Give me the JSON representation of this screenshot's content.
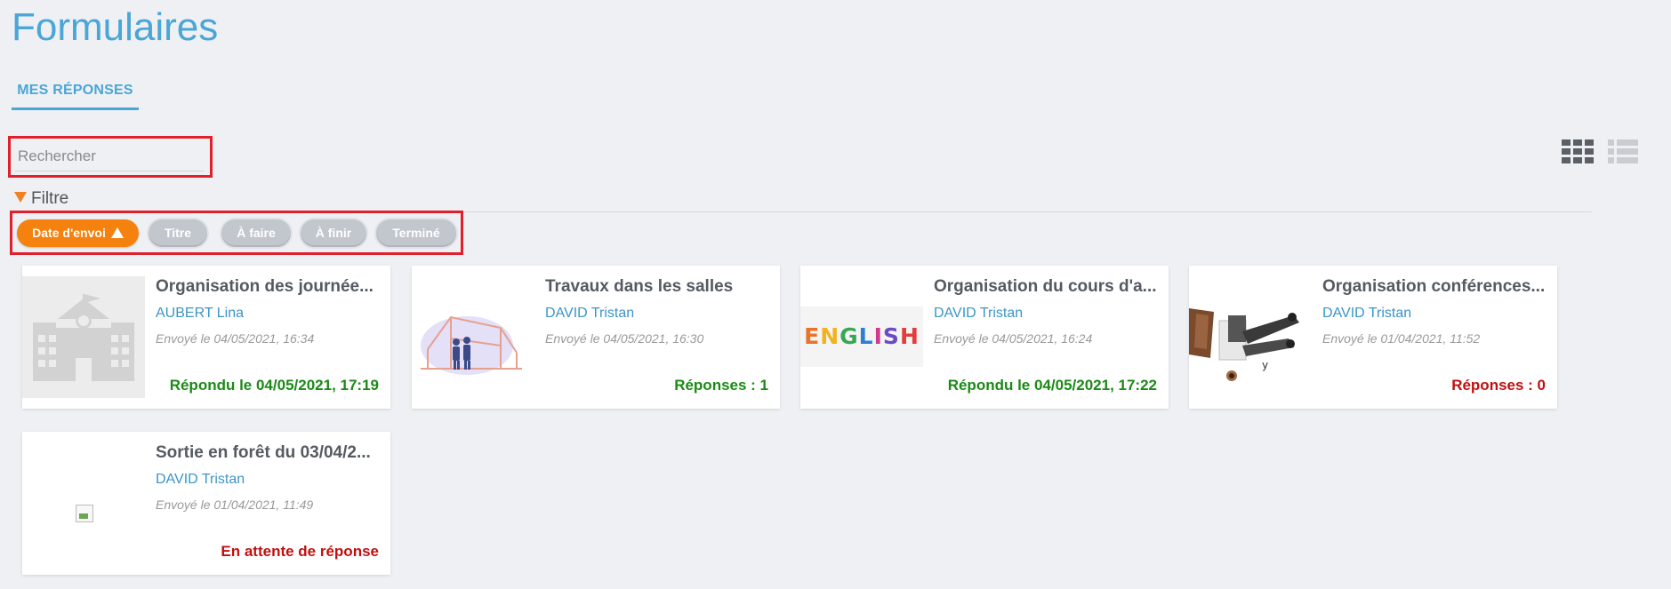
{
  "page": {
    "title": "Formulaires"
  },
  "tabs": [
    {
      "label": "MES RÉPONSES",
      "active": true
    }
  ],
  "search": {
    "placeholder": "Rechercher",
    "value": ""
  },
  "view_toggle": {
    "grid_icon": "grid-view-icon",
    "list_icon": "list-view-icon",
    "active": "grid"
  },
  "filter": {
    "label": "Filtre",
    "arrow_icon": "triangle-down-icon",
    "pills": [
      {
        "label": "Date d'envoi",
        "active": true,
        "sort_icon": "triangle-up-icon"
      },
      {
        "label": "Titre",
        "active": false
      },
      {
        "label": "À faire",
        "active": false
      },
      {
        "label": "À finir",
        "active": false
      },
      {
        "label": "Terminé",
        "active": false
      }
    ]
  },
  "colors": {
    "accent": "#4aa6d6",
    "active_pill": "#f5820e",
    "status_green": "#1b8a16",
    "status_red": "#c01010",
    "highlight_border": "#e0202a"
  },
  "cards": [
    {
      "title": "Organisation des journée...",
      "author": "AUBERT Lina",
      "sent": "Envoyé le 04/05/2021, 16:34",
      "status": "Répondu le 04/05/2021, 17:19",
      "status_color": "green",
      "thumbnail": "school-building-icon"
    },
    {
      "title": "Travaux dans les salles",
      "author": "DAVID Tristan",
      "sent": "Envoyé le 04/05/2021, 16:30",
      "status": "Réponses : 1",
      "status_color": "green",
      "thumbnail": "construction-illustration"
    },
    {
      "title": "Organisation du cours d'a...",
      "author": "DAVID Tristan",
      "sent": "Envoyé le 04/05/2021, 16:24",
      "status": "Répondu le 04/05/2021, 17:22",
      "status_color": "green",
      "thumbnail": "english-text-image",
      "thumbnail_text": "ENGLISH"
    },
    {
      "title": "Organisation conférences...",
      "author": "DAVID Tristan",
      "sent": "Envoyé le 01/04/2021, 11:52",
      "status": "Réponses : 0",
      "status_color": "red",
      "thumbnail": "desk-illustration"
    },
    {
      "title": "Sortie en forêt du 03/04/2...",
      "author": "DAVID Tristan",
      "sent": "Envoyé le 01/04/2021, 11:49",
      "status": "En attente de réponse",
      "status_color": "red",
      "thumbnail": "broken-image-icon"
    }
  ]
}
